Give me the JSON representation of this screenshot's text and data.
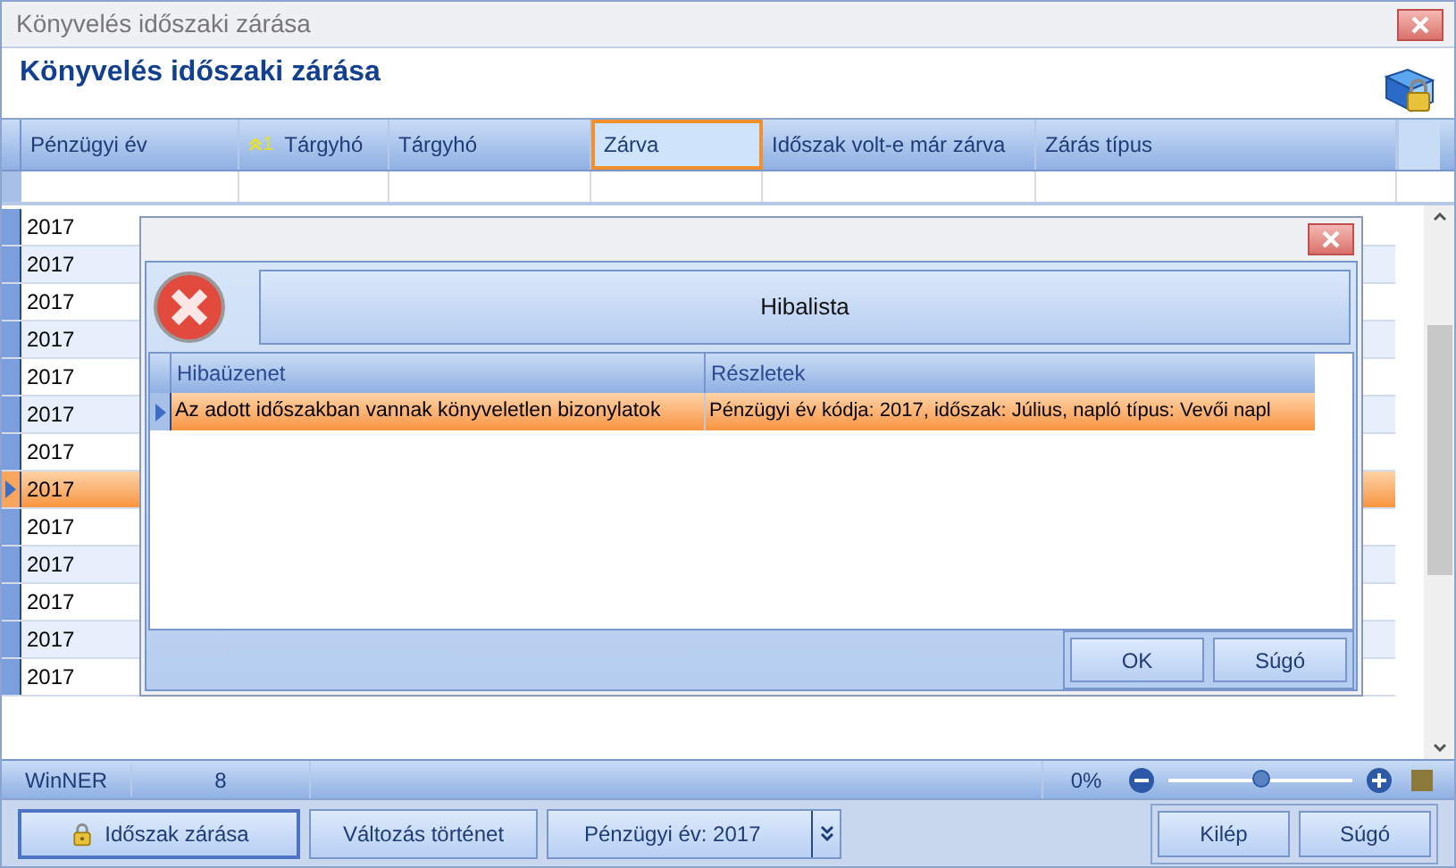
{
  "window": {
    "title": "Könyvelés időszaki zárása"
  },
  "header": {
    "title": "Könyvelés időszaki zárása"
  },
  "grid": {
    "columns": [
      {
        "label": "Pénzügyi év",
        "focused": false
      },
      {
        "label": "Tárgyhó",
        "sort_index": "1",
        "focused": false
      },
      {
        "label": "Tárgyhó",
        "focused": false
      },
      {
        "label": "Zárva",
        "focused": true
      },
      {
        "label": "Időszak volt-e már zárva",
        "focused": false
      },
      {
        "label": "Zárás típus",
        "focused": false
      }
    ],
    "rows": [
      {
        "year": "2017",
        "selected": false
      },
      {
        "year": "2017",
        "selected": false
      },
      {
        "year": "2017",
        "selected": false
      },
      {
        "year": "2017",
        "selected": false
      },
      {
        "year": "2017",
        "selected": false
      },
      {
        "year": "2017",
        "selected": false
      },
      {
        "year": "2017",
        "selected": false
      },
      {
        "year": "2017",
        "selected": true
      },
      {
        "year": "2017",
        "selected": false
      },
      {
        "year": "2017",
        "selected": false
      },
      {
        "year": "2017",
        "selected": false
      },
      {
        "year": "2017",
        "selected": false
      },
      {
        "year": "2017",
        "selected": false
      }
    ]
  },
  "status_bar": {
    "app": "WinNER",
    "count": "8",
    "zoom": "0%",
    "level": 0.5
  },
  "footer": {
    "buttons": [
      {
        "label": "Időszak zárása",
        "kind": "lock"
      },
      {
        "label": "Változás történet",
        "kind": "plain"
      },
      {
        "label": "Pénzügyi év: 2017",
        "kind": "dropdown"
      }
    ],
    "right_buttons": [
      "Kilép",
      "Súgó"
    ]
  },
  "dialog": {
    "header": "Hibalista",
    "columns": [
      "Hibaüzenet",
      "Részletek"
    ],
    "rows": [
      {
        "message": "Az adott időszakban vannak könyveletlen bizonylatok",
        "details": "Pénzügyi év kódja: 2017, időszak: Július, napló típus: Vevői napl",
        "selected": true
      }
    ],
    "buttons": [
      "OK",
      "Súgó"
    ]
  }
}
